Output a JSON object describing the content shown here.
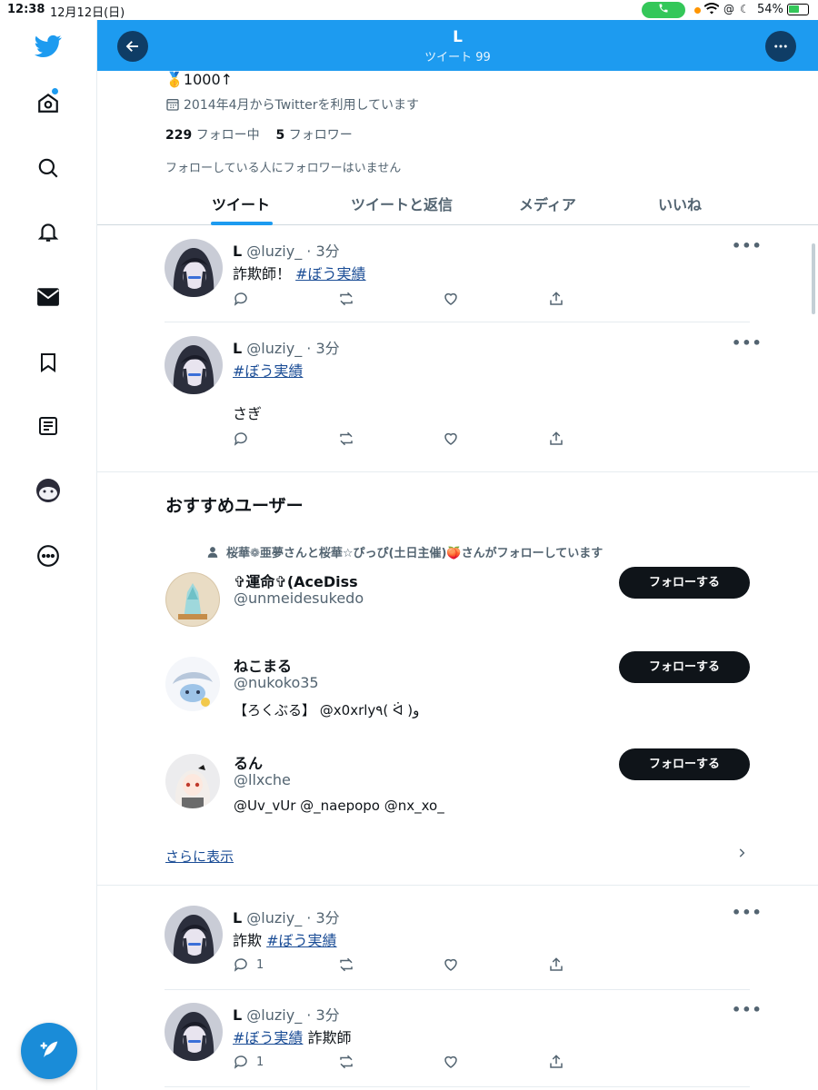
{
  "status_bar": {
    "time": "12:38",
    "date": "12月12日(日)",
    "battery": "54%"
  },
  "header": {
    "title": "L",
    "subtitle": "ツイート 99"
  },
  "profile": {
    "bio": "🥇1000↑",
    "joined": "2014年4月からTwitterを利用しています",
    "following_count": "229",
    "following_label": "フォロー中",
    "followers_count": "5",
    "followers_label": "フォロワー",
    "note": "フォローしている人にフォロワーはいません"
  },
  "tabs": [
    "ツイート",
    "ツイートと返信",
    "メディア",
    "いいね"
  ],
  "tweets": [
    {
      "name": "L",
      "handle": "@luziy_",
      "time": "· 3分",
      "text": "詐欺師！",
      "hashtag": "#ぼう実績",
      "text_after": "",
      "extra": "",
      "reply_count": ""
    },
    {
      "name": "L",
      "handle": "@luziy_",
      "time": "· 3分",
      "text": "",
      "hashtag": "#ぼう実績",
      "text_after": "",
      "extra": "さぎ",
      "reply_count": ""
    },
    {
      "name": "L",
      "handle": "@luziy_",
      "time": "· 3分",
      "text": "詐欺",
      "hashtag": "#ぼう実績",
      "text_after": "",
      "extra": "",
      "reply_count": "1"
    },
    {
      "name": "L",
      "handle": "@luziy_",
      "time": "· 3分",
      "text": "",
      "hashtag": "#ぼう実績",
      "text_after": "詐欺師",
      "extra": "",
      "reply_count": "1"
    }
  ],
  "recommend": {
    "title": "おすすめユーザー",
    "social_context": "桜華❁亜夢さんと桜華☆ぴっぴ(土日主催)🍑さんがフォローしています",
    "users": [
      {
        "name": "✞運命✞(AceDiss",
        "handle": "@unmeidesukedo",
        "bio": "",
        "button": "フォローする"
      },
      {
        "name": "ねこまる",
        "handle": "@nukoko35",
        "bio": "【ろくぶる】 @x0xrly٩( ᐛ )و",
        "button": "フォローする"
      },
      {
        "name": "るん",
        "handle": "@llxche",
        "bio": "@Uv_vUr @_naepopo @nx_xo_",
        "button": "フォローする"
      }
    ],
    "show_more": "さらに表示"
  },
  "icons": {
    "sidebar": [
      "twitter-logo-icon",
      "home-icon",
      "search-icon",
      "bell-icon",
      "mail-icon",
      "bookmark-icon",
      "list-icon",
      "profile-avatar-icon",
      "more-circle-icon"
    ],
    "compose": "compose-icon"
  },
  "colors": {
    "accent": "#1d9bf0",
    "header_button": "#0f3d66",
    "link": "#1b4d96",
    "follow_button": "#0f1419"
  }
}
